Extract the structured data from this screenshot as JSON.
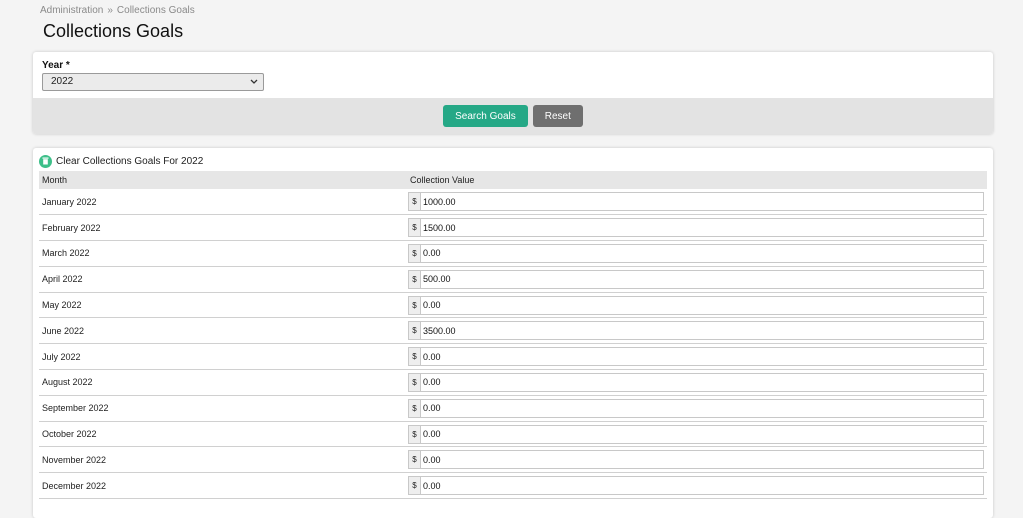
{
  "breadcrumb": {
    "items": [
      "Administration",
      "Collections Goals"
    ],
    "separator": "»"
  },
  "page": {
    "title": "Collections Goals"
  },
  "filter": {
    "year_label": "Year *",
    "year_value": "2022",
    "search_label": "Search Goals",
    "reset_label": "Reset"
  },
  "goals": {
    "clear_label": "Clear Collections Goals For 2022",
    "columns": {
      "month": "Month",
      "value": "Collection Value"
    },
    "currency": "$",
    "rows": [
      {
        "month": "January 2022",
        "value": "1000.00"
      },
      {
        "month": "February 2022",
        "value": "1500.00"
      },
      {
        "month": "March 2022",
        "value": "0.00"
      },
      {
        "month": "April 2022",
        "value": "500.00"
      },
      {
        "month": "May 2022",
        "value": "0.00"
      },
      {
        "month": "June 2022",
        "value": "3500.00"
      },
      {
        "month": "July 2022",
        "value": "0.00"
      },
      {
        "month": "August 2022",
        "value": "0.00"
      },
      {
        "month": "September 2022",
        "value": "0.00"
      },
      {
        "month": "October 2022",
        "value": "0.00"
      },
      {
        "month": "November 2022",
        "value": "0.00"
      },
      {
        "month": "December 2022",
        "value": "0.00"
      }
    ]
  },
  "colors": {
    "primary_button": "#25a886",
    "secondary_button": "#6f6f6f",
    "clear_icon": "#3dbf89"
  },
  "icons": {
    "clear": "trash-icon",
    "select": "chevron-down-icon"
  }
}
